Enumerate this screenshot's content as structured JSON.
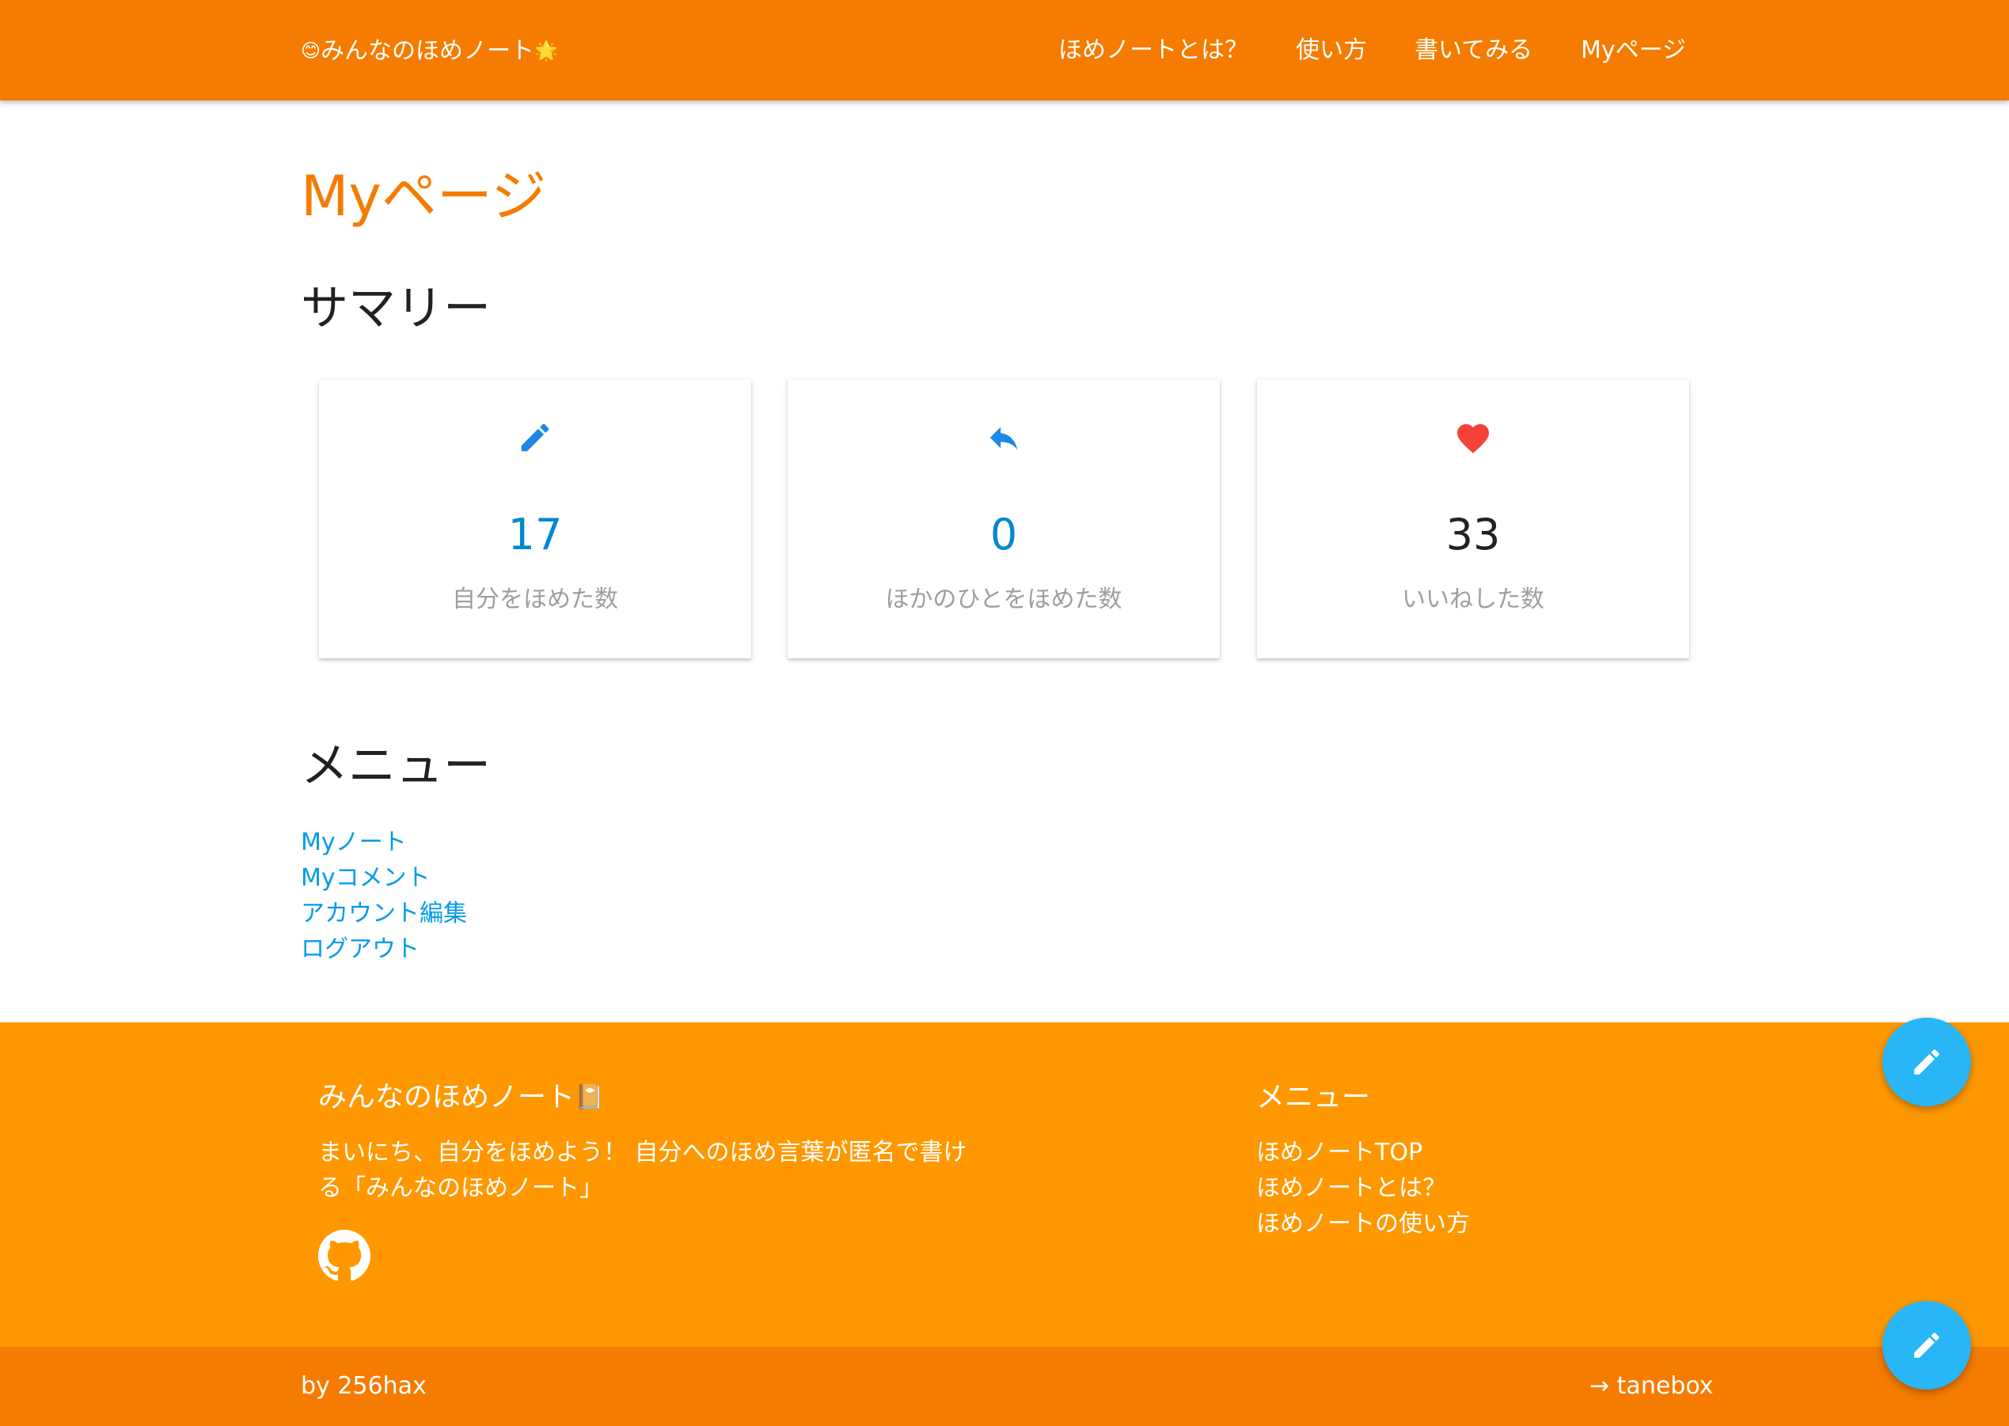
{
  "colors": {
    "navbar": "#f57c00",
    "footer": "#ff9800",
    "accent_title": "#f57c00",
    "link": "#039be5",
    "fab": "#29b6f6",
    "heart": "#f44336"
  },
  "header": {
    "brand_emoji_left": "😊",
    "brand": "みんなのほめノート",
    "brand_emoji_right": "🌟",
    "nav": [
      {
        "label": "ほめノートとは？"
      },
      {
        "label": "使い方"
      },
      {
        "label": "書いてみる"
      },
      {
        "label": "Myページ"
      }
    ]
  },
  "main": {
    "title": "Myページ",
    "summary_title": "サマリー",
    "cards": [
      {
        "icon": "pencil-icon",
        "value": "17",
        "label": "自分をほめた数"
      },
      {
        "icon": "reply-icon",
        "value": "0",
        "label": "ほかのひとをほめた数"
      },
      {
        "icon": "heart-icon",
        "value": "33",
        "label": "いいねした数"
      }
    ],
    "menu_title": "メニュー",
    "menu": [
      {
        "label": "Myノート"
      },
      {
        "label": "Myコメント"
      },
      {
        "label": "アカウント編集"
      },
      {
        "label": "ログアウト"
      }
    ]
  },
  "footer": {
    "title": "みんなのほめノート",
    "title_emoji": "📔",
    "description": "まいにち、自分をほめよう！ 自分へのほめ言葉が匿名で書ける「みんなのほめノート」",
    "github_icon": "github-icon",
    "menu_title": "メニュー",
    "menu": [
      {
        "label": "ほめノートTOP"
      },
      {
        "label": "ほめノートとは？"
      },
      {
        "label": "ほめノートの使い方"
      }
    ],
    "byline": "by 256hax",
    "external_link": "→ tanebox"
  },
  "fab": {
    "icon": "pencil-icon"
  }
}
